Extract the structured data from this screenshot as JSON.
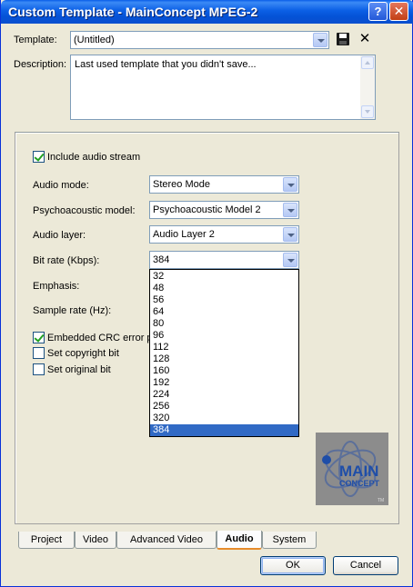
{
  "window": {
    "title": "Custom Template - MainConcept MPEG-2",
    "help_label": "?",
    "close_label": "✕"
  },
  "template": {
    "label": "Template:",
    "value": "(Untitled)",
    "delete_glyph": "✕"
  },
  "description": {
    "label": "Description:",
    "value": "Last used template that you didn't save..."
  },
  "audio": {
    "include_audio_label": "Include audio stream",
    "include_audio_checked": true,
    "audio_mode_label": "Audio mode:",
    "audio_mode_value": "Stereo Mode",
    "psycho_label": "Psychoacoustic model:",
    "psycho_value": "Psychoacoustic Model 2",
    "layer_label": "Audio layer:",
    "layer_value": "Audio Layer 2",
    "bitrate_label": "Bit rate (Kbps):",
    "bitrate_value": "384",
    "emphasis_label": "Emphasis:",
    "sample_rate_label": "Sample rate (Hz):",
    "crc_label": "Embedded CRC error pr",
    "crc_checked": true,
    "copyright_label": "Set copyright bit",
    "copyright_checked": false,
    "original_label": "Set original bit",
    "original_checked": false
  },
  "bitrate_options": [
    "32",
    "48",
    "56",
    "64",
    "80",
    "96",
    "112",
    "128",
    "160",
    "192",
    "224",
    "256",
    "320",
    "384"
  ],
  "bitrate_selected": "384",
  "logo": {
    "line1": "MAIN",
    "line2": "CONCEPT",
    "mark": "TM"
  },
  "tabs": [
    {
      "label": "Project",
      "active": false
    },
    {
      "label": "Video",
      "active": false
    },
    {
      "label": "Advanced Video",
      "active": false
    },
    {
      "label": "Audio",
      "active": true
    },
    {
      "label": "System",
      "active": false
    }
  ],
  "buttons": {
    "ok": "OK",
    "cancel": "Cancel"
  },
  "colors": {
    "titlebar": "#0a5de8",
    "selection": "#316ac5",
    "active_tab_underline": "#e68b2c"
  }
}
